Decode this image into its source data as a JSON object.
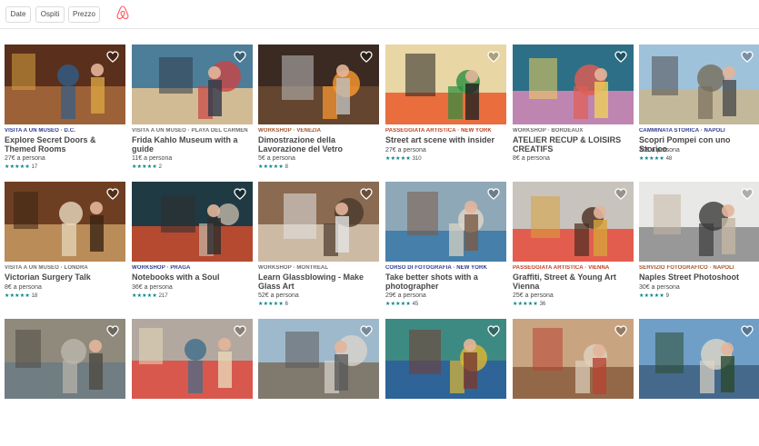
{
  "filters": {
    "date": "Date",
    "guests": "Ospiti",
    "price": "Prezzo"
  },
  "brand_color": "#FF5A5F",
  "cards": [
    {
      "category": "Visita a un museo · D.C.",
      "title": "Explore Secret Doors & Themed Rooms",
      "price": "27€ a persona",
      "stars": "★★★★★",
      "reviews": "17",
      "cat_color": "#2c3a8f"
    },
    {
      "category": "Visita a un museo · Playa del Carmen",
      "title": "Frida Kahlo Museum with a guide",
      "price": "11€ a persona",
      "stars": "★★★★★",
      "reviews": "2",
      "cat_color": "#6b6b6b"
    },
    {
      "category": "Workshop · Venezia",
      "title": "Dimostrazione della Lavorazione del Vetro",
      "price": "5€ a persona",
      "stars": "★★★★★",
      "reviews": "8",
      "cat_color": "#a3532a"
    },
    {
      "category": "Passeggiata artistica · New York",
      "title": "Street art scene with insider",
      "price": "27€ a persona",
      "stars": "★★★★★",
      "reviews": "310",
      "cat_color": "#c13c1f"
    },
    {
      "category": "Workshop · Bordeaux",
      "title": "ATELIER RECUP & LOISIRS CREATIFS",
      "price": "8€ a persona",
      "stars": "",
      "reviews": "",
      "cat_color": "#6b6b6b"
    },
    {
      "category": "Camminata storica · Napoli",
      "title": "Scopri Pompei con uno Storico",
      "price": "30€ a persona",
      "stars": "★★★★★",
      "reviews": "48",
      "cat_color": "#2c3a8f"
    },
    {
      "category": "Visita a un museo · Londra",
      "title": "Victorian Surgery Talk",
      "price": "8€ a persona",
      "stars": "★★★★★",
      "reviews": "18",
      "cat_color": "#6b6b6b"
    },
    {
      "category": "Workshop · Praga",
      "title": "Notebooks with a Soul",
      "price": "36€ a persona",
      "stars": "★★★★★",
      "reviews": "217",
      "cat_color": "#2c3a8f"
    },
    {
      "category": "Workshop · Montreal",
      "title": "Learn Glassblowing - Make Glass Art",
      "price": "52€ a persona",
      "stars": "★★★★★",
      "reviews": "6",
      "cat_color": "#6b6b6b"
    },
    {
      "category": "Corso di fotografia · New York",
      "title": "Take better shots with a photographer",
      "price": "29€ a persona",
      "stars": "★★★★★",
      "reviews": "45",
      "cat_color": "#2c3a8f"
    },
    {
      "category": "Passeggiata artistica · Vienna",
      "title": "Graffiti, Street & Young Art Vienna",
      "price": "25€ a persona",
      "stars": "★★★★★",
      "reviews": "36",
      "cat_color": "#c13c1f"
    },
    {
      "category": "Servizio fotografico · Napoli",
      "title": "Naples Street Photoshoot",
      "price": "30€ a persona",
      "stars": "★★★★★",
      "reviews": "9",
      "cat_color": "#a3532a"
    },
    {
      "category": "",
      "title": "",
      "price": "",
      "stars": "",
      "reviews": "",
      "cat_color": "#6b6b6b"
    },
    {
      "category": "",
      "title": "",
      "price": "",
      "stars": "",
      "reviews": "",
      "cat_color": "#6b6b6b"
    },
    {
      "category": "",
      "title": "",
      "price": "",
      "stars": "",
      "reviews": "",
      "cat_color": "#6b6b6b"
    },
    {
      "category": "",
      "title": "",
      "price": "",
      "stars": "",
      "reviews": "",
      "cat_color": "#6b6b6b"
    },
    {
      "category": "",
      "title": "",
      "price": "",
      "stars": "",
      "reviews": "",
      "cat_color": "#6b6b6b"
    },
    {
      "category": "",
      "title": "",
      "price": "",
      "stars": "",
      "reviews": "",
      "cat_color": "#6b6b6b"
    }
  ]
}
